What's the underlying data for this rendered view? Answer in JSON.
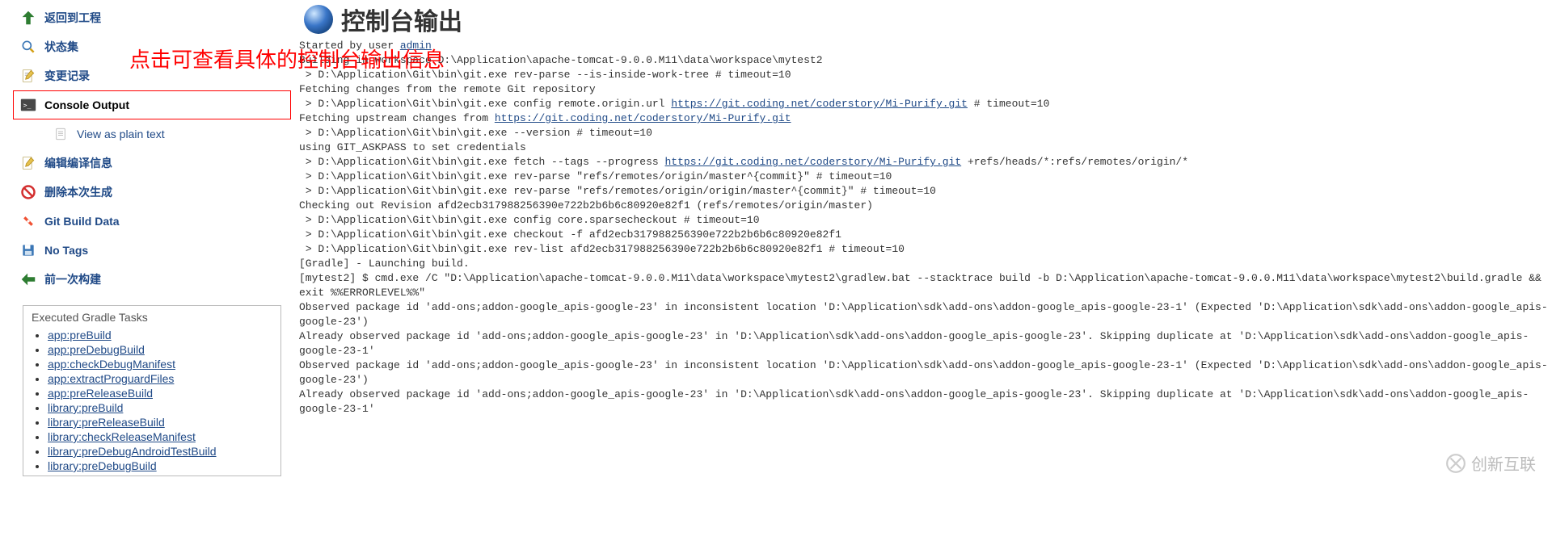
{
  "sidebar": {
    "items": [
      {
        "key": "back",
        "label": "返回到工程"
      },
      {
        "key": "status",
        "label": "状态集"
      },
      {
        "key": "changes",
        "label": "变更记录"
      },
      {
        "key": "console",
        "label": "Console Output"
      },
      {
        "key": "plain",
        "label": "View as plain text"
      },
      {
        "key": "editcfg",
        "label": "编辑编译信息"
      },
      {
        "key": "delete",
        "label": "删除本次生成"
      },
      {
        "key": "gitdata",
        "label": "Git Build Data"
      },
      {
        "key": "notags",
        "label": "No Tags"
      },
      {
        "key": "prev",
        "label": "前一次构建"
      }
    ]
  },
  "tasks": {
    "title": "Executed Gradle Tasks",
    "items": [
      "app:preBuild",
      "app:preDebugBuild",
      "app:checkDebugManifest",
      "app:extractProguardFiles",
      "app:preReleaseBuild",
      "library:preBuild",
      "library:preReleaseBuild",
      "library:checkReleaseManifest",
      "library:preDebugAndroidTestBuild",
      "library:preDebugBuild"
    ]
  },
  "page": {
    "title": "控制台输出",
    "annotation": "点击可查看具体的控制台输出信息",
    "started_prefix": "Started by user ",
    "started_user": "admin",
    "lines_before_url1": "Building in workspace D:\\Application\\apache-tomcat-9.0.0.M11\\data\\workspace\\mytest2\n > D:\\Application\\Git\\bin\\git.exe rev-parse --is-inside-work-tree # timeout=10\nFetching changes from the remote Git repository\n > D:\\Application\\Git\\bin\\git.exe config remote.origin.url ",
    "url1": "https://git.coding.net/coderstory/Mi-Purify.git",
    "after_url1": " # timeout=10\nFetching upstream changes from ",
    "url2": "https://git.coding.net/coderstory/Mi-Purify.git",
    "after_url2": "\n > D:\\Application\\Git\\bin\\git.exe --version # timeout=10\nusing GIT_ASKPASS to set credentials \n > D:\\Application\\Git\\bin\\git.exe fetch --tags --progress ",
    "url3": "https://git.coding.net/coderstory/Mi-Purify.git",
    "after_url3": " +refs/heads/*:refs/remotes/origin/*\n > D:\\Application\\Git\\bin\\git.exe rev-parse \"refs/remotes/origin/master^{commit}\" # timeout=10\n > D:\\Application\\Git\\bin\\git.exe rev-parse \"refs/remotes/origin/origin/master^{commit}\" # timeout=10\nChecking out Revision afd2ecb317988256390e722b2b6b6c80920e82f1 (refs/remotes/origin/master)\n > D:\\Application\\Git\\bin\\git.exe config core.sparsecheckout # timeout=10\n > D:\\Application\\Git\\bin\\git.exe checkout -f afd2ecb317988256390e722b2b6b6c80920e82f1\n > D:\\Application\\Git\\bin\\git.exe rev-list afd2ecb317988256390e722b2b6b6c80920e82f1 # timeout=10\n[Gradle] - Launching build.\n[mytest2] $ cmd.exe /C \"D:\\Application\\apache-tomcat-9.0.0.M11\\data\\workspace\\mytest2\\gradlew.bat --stacktrace build -b D:\\Application\\apache-tomcat-9.0.0.M11\\data\\workspace\\mytest2\\build.gradle && exit %%ERRORLEVEL%%\"\nObserved package id 'add-ons;addon-google_apis-google-23' in inconsistent location 'D:\\Application\\sdk\\add-ons\\addon-google_apis-google-23-1' (Expected 'D:\\Application\\sdk\\add-ons\\addon-google_apis-google-23')\nAlready observed package id 'add-ons;addon-google_apis-google-23' in 'D:\\Application\\sdk\\add-ons\\addon-google_apis-google-23'. Skipping duplicate at 'D:\\Application\\sdk\\add-ons\\addon-google_apis-google-23-1'\nObserved package id 'add-ons;addon-google_apis-google-23' in inconsistent location 'D:\\Application\\sdk\\add-ons\\addon-google_apis-google-23-1' (Expected 'D:\\Application\\sdk\\add-ons\\addon-google_apis-google-23')\nAlready observed package id 'add-ons;addon-google_apis-google-23' in 'D:\\Application\\sdk\\add-ons\\addon-google_apis-google-23'. Skipping duplicate at 'D:\\Application\\sdk\\add-ons\\addon-google_apis-google-23-1'"
  },
  "watermark": "创新互联"
}
